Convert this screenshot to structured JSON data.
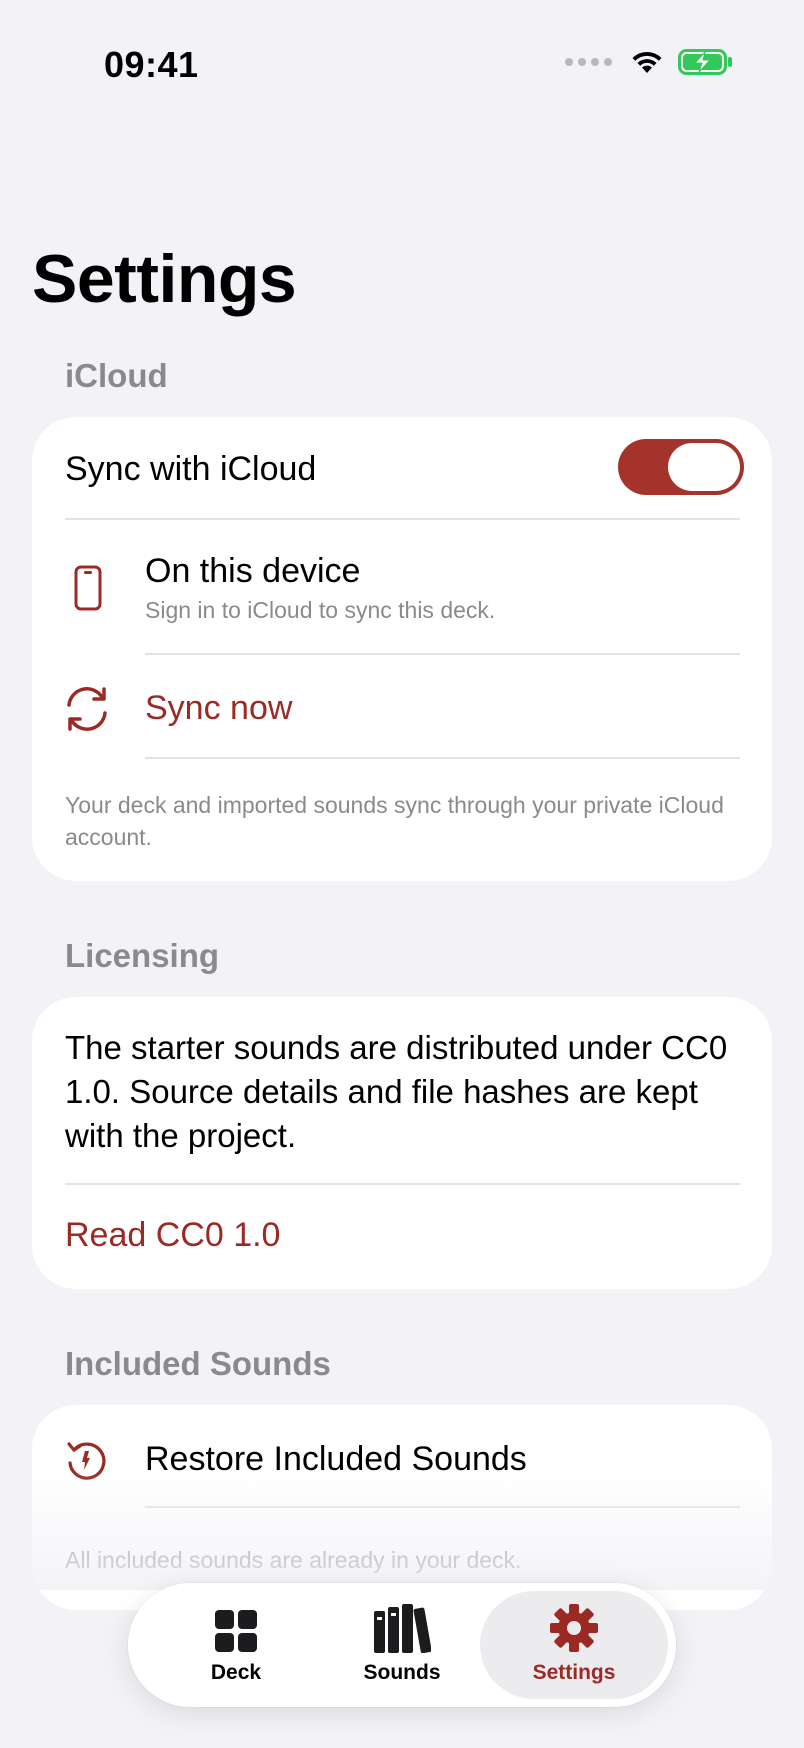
{
  "status_bar": {
    "time": "09:41"
  },
  "title": "Settings",
  "icloud": {
    "header": "iCloud",
    "sync_label": "Sync with iCloud",
    "sync_enabled": true,
    "device_title": "On this device",
    "device_subtitle": "Sign in to iCloud to sync this deck.",
    "sync_now_label": "Sync now",
    "footnote": "Your deck and imported sounds sync through your private iCloud account."
  },
  "licensing": {
    "header": "Licensing",
    "body": "The starter sounds are distributed under CC0 1.0. Source details and file hashes are kept with the project.",
    "link_label": "Read CC0 1.0"
  },
  "included": {
    "header": "Included Sounds",
    "restore_label": "Restore Included Sounds",
    "footnote": "All included sounds are already in your deck."
  },
  "tab_bar": {
    "tabs": [
      {
        "label": "Deck",
        "icon": "grid-icon"
      },
      {
        "label": "Sounds",
        "icon": "books-icon"
      },
      {
        "label": "Settings",
        "icon": "gear-icon"
      }
    ],
    "selected": "Settings"
  },
  "colors": {
    "accent": "#9b2a24",
    "background": "#f2f2f7"
  }
}
